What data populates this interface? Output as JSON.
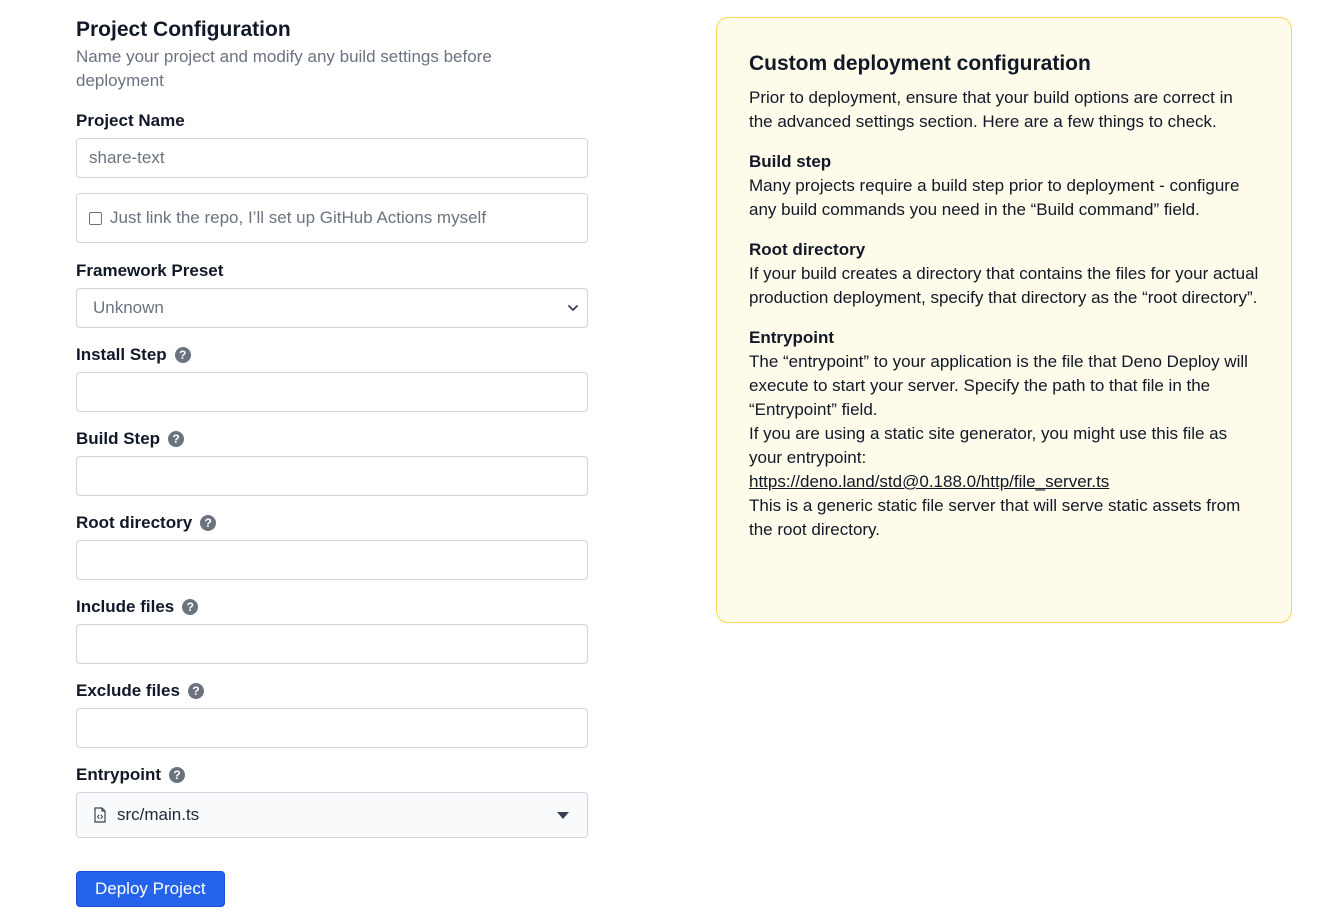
{
  "header": {
    "title": "Project Configuration",
    "subtitle": "Name your project and modify any build settings before deployment"
  },
  "project_name": {
    "label": "Project Name",
    "value": "share-text"
  },
  "link_repo": {
    "label": "Just link the repo, I’ll set up GitHub Actions myself",
    "checked": false
  },
  "framework_preset": {
    "label": "Framework Preset",
    "selected": "Unknown"
  },
  "install_step": {
    "label": "Install Step",
    "value": ""
  },
  "build_step": {
    "label": "Build Step",
    "value": ""
  },
  "root_directory": {
    "label": "Root directory",
    "value": ""
  },
  "include_files": {
    "label": "Include files",
    "value": ""
  },
  "exclude_files": {
    "label": "Exclude files",
    "value": ""
  },
  "entrypoint": {
    "label": "Entrypoint",
    "selected": "src/main.ts"
  },
  "actions": {
    "deploy_label": "Deploy Project"
  },
  "help_glyph": "?",
  "info_panel": {
    "title": "Custom deployment configuration",
    "intro": "Prior to deployment, ensure that your build options are correct in the advanced settings section. Here are a few things to check.",
    "sections": [
      {
        "heading": "Build step",
        "body": "Many projects require a build step prior to deployment - configure any build commands you need in the “Build command” field."
      },
      {
        "heading": "Root directory",
        "body": "If your build creates a directory that contains the files for your actual production deployment, specify that directory as the “root directory”."
      },
      {
        "heading": "Entrypoint",
        "body": "The “entrypoint” to your application is the file that Deno Deploy will execute to start your server. Specify the path to that file in the “Entrypoint” field.",
        "body2": "If you are using a static site generator, you might use this file as your entrypoint:",
        "link": "https://deno.land/std@0.188.0/http/file_server.ts",
        "body3": "This is a generic static file server that will serve static assets from the root directory."
      }
    ]
  },
  "colors": {
    "primary": "#2563eb",
    "info_bg": "#fefbeb",
    "info_border": "#fcd34d",
    "muted_text": "#6b7280"
  }
}
